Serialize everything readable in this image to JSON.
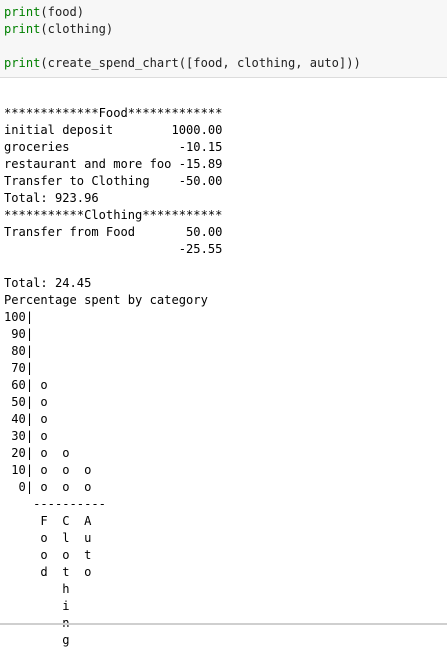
{
  "colors": {
    "keyword": "#008000",
    "code_text": "#212121",
    "output_text": "#000000",
    "input_bg": "#f7f7f7"
  },
  "code": {
    "lines": [
      {
        "kw": "print",
        "rest": "(food)"
      },
      {
        "kw": "print",
        "rest": "(clothing)"
      },
      {
        "kw": "",
        "rest": ""
      },
      {
        "kw": "print",
        "rest": "(create_spend_chart([food, clothing, auto]))"
      }
    ]
  },
  "output": {
    "lines": [
      "*************Food*************",
      "initial deposit        1000.00",
      "groceries               -10.15",
      "restaurant and more foo -15.89",
      "Transfer to Clothing    -50.00",
      "Total: 923.96",
      "***********Clothing***********",
      "Transfer from Food       50.00",
      "                        -25.55",
      "",
      "Total: 24.45",
      "Percentage spent by category",
      "100|",
      " 90|",
      " 80|",
      " 70|",
      " 60| o",
      " 50| o",
      " 40| o",
      " 30| o",
      " 20| o  o",
      " 10| o  o  o",
      "  0| o  o  o",
      "    ----------",
      "     F  C  A",
      "     o  l  u",
      "     o  o  t",
      "     d  t  o",
      "        h",
      "        i",
      "        n",
      "        g"
    ]
  }
}
